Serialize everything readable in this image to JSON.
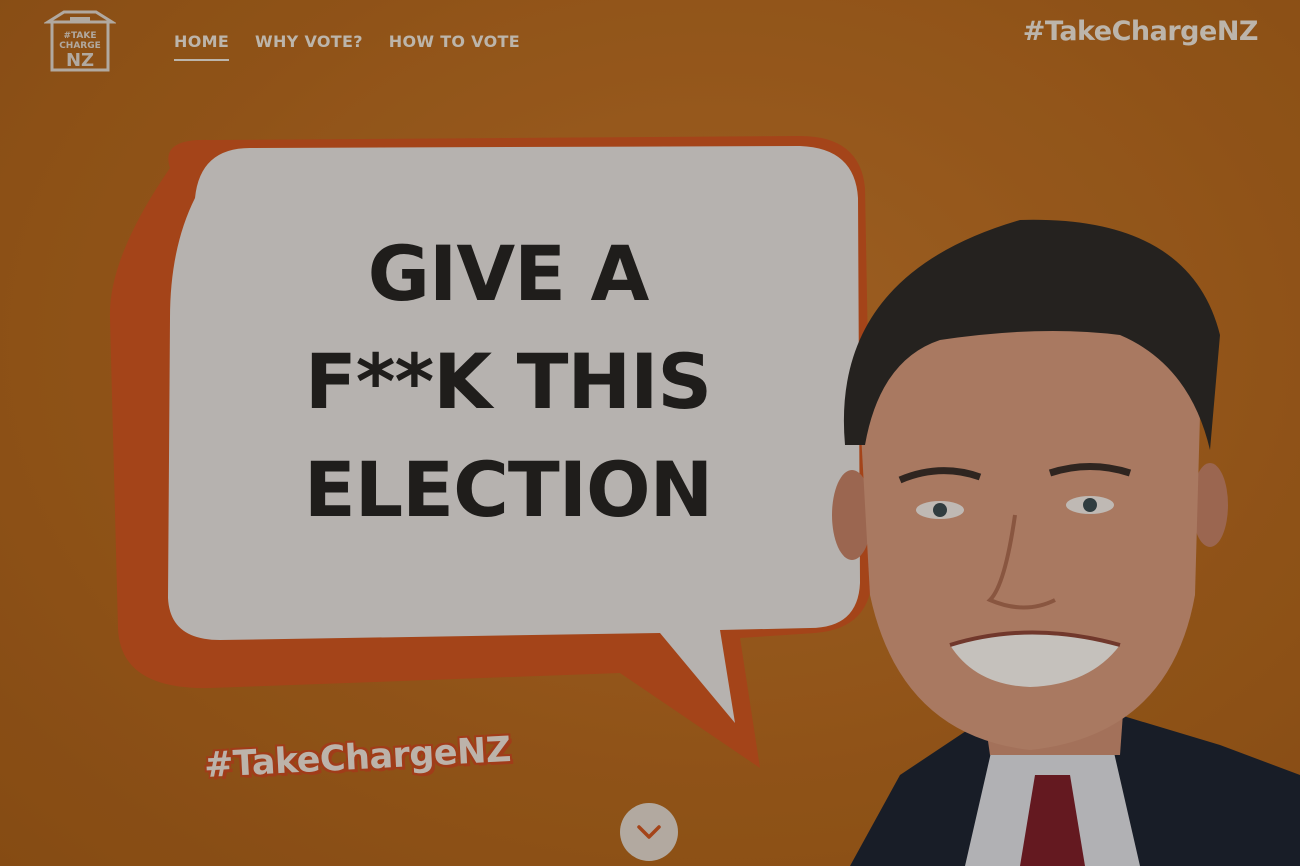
{
  "header": {
    "logo_text": [
      "#TAKE",
      "CHARGE",
      "NZ"
    ],
    "nav": [
      {
        "label": "HOME",
        "active": true
      },
      {
        "label": "WHY VOTE?",
        "active": false
      },
      {
        "label": "HOW TO VOTE",
        "active": false
      }
    ],
    "hashtag": "#TakeChargeNZ"
  },
  "hero": {
    "headline_lines": [
      "GIVE A",
      "F**K THIS",
      "ELECTION"
    ],
    "hashtag": "#TakeChargeNZ",
    "scroll_icon": "chevron-down-icon"
  },
  "colors": {
    "background": "#b4691e",
    "bubble_fill": "#dedad6",
    "bubble_shadow": "#c9531f",
    "headline": "#262422",
    "nav_text": "#e6ddd1"
  }
}
